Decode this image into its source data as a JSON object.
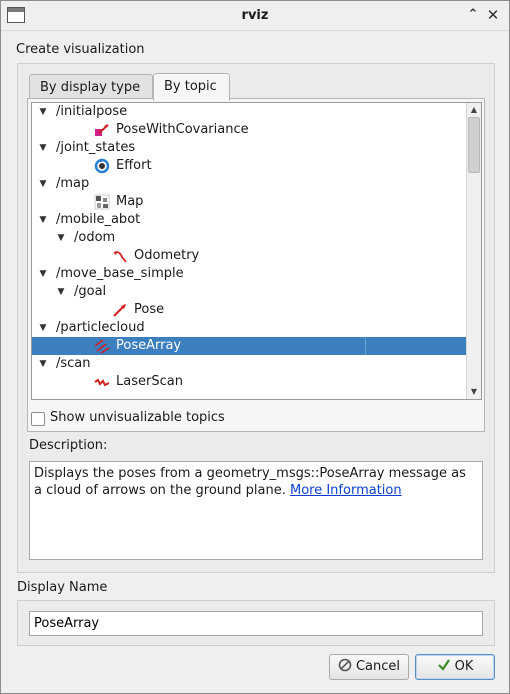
{
  "window": {
    "title": "rviz"
  },
  "heading": "Create visualization",
  "tabs": [
    {
      "label": "By display type",
      "active": false
    },
    {
      "label": "By topic",
      "active": true
    }
  ],
  "tree": [
    {
      "label": "/initialpose",
      "depth": 0,
      "expandable": true
    },
    {
      "label": "PoseWithCovariance",
      "depth": 1,
      "icon": "pose-with-covariance-icon"
    },
    {
      "label": "/joint_states",
      "depth": 0,
      "expandable": true
    },
    {
      "label": "Effort",
      "depth": 1,
      "icon": "effort-icon"
    },
    {
      "label": "/map",
      "depth": 0,
      "expandable": true
    },
    {
      "label": "Map",
      "depth": 1,
      "icon": "map-icon"
    },
    {
      "label": "/mobile_abot",
      "depth": 0,
      "expandable": true
    },
    {
      "label": "/odom",
      "depth": 1,
      "expandable": true
    },
    {
      "label": "Odometry",
      "depth": 2,
      "icon": "odometry-icon"
    },
    {
      "label": "/move_base_simple",
      "depth": 0,
      "expandable": true
    },
    {
      "label": "/goal",
      "depth": 1,
      "expandable": true
    },
    {
      "label": "Pose",
      "depth": 2,
      "icon": "pose-icon"
    },
    {
      "label": "/particlecloud",
      "depth": 0,
      "expandable": true
    },
    {
      "label": "PoseArray",
      "depth": 1,
      "icon": "pose-array-icon",
      "selected": true
    },
    {
      "label": "/scan",
      "depth": 0,
      "expandable": true
    },
    {
      "label": "LaserScan",
      "depth": 1,
      "icon": "laser-scan-icon"
    }
  ],
  "show_unvisualizable": {
    "label": "Show unvisualizable topics",
    "checked": false
  },
  "description": {
    "label": "Description:",
    "text": "Displays the poses from a geometry_msgs::PoseArray message as a cloud of arrows on the ground plane. ",
    "link": "More Information"
  },
  "display_name": {
    "label": "Display Name",
    "value": "PoseArray"
  },
  "buttons": {
    "cancel": "Cancel",
    "ok": "OK"
  },
  "colors": {
    "selection": "#3b7fbf",
    "link": "#0b3fd2",
    "icon_red": "#d42020"
  }
}
